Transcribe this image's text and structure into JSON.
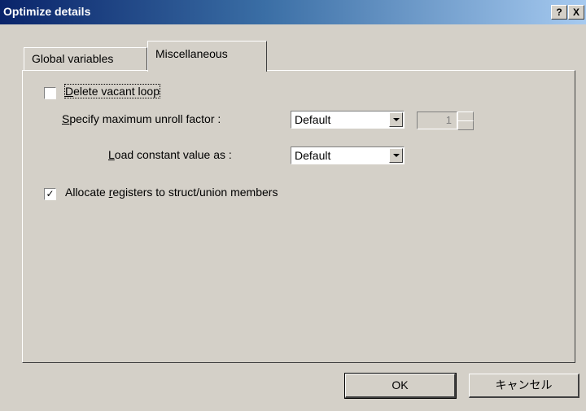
{
  "window": {
    "title": "Optimize details",
    "help_button": "?",
    "close_button": "X"
  },
  "tabs": [
    {
      "label": "Global variables",
      "active": false
    },
    {
      "label": "Miscellaneous",
      "active": true
    }
  ],
  "options": {
    "delete_vacant_loop": {
      "mnemonic": "D",
      "rest": "elete vacant loop",
      "checked": false
    },
    "unroll_factor": {
      "mnemonic": "S",
      "rest": "pecify maximum unroll factor :",
      "value": "Default",
      "spin_value": "1"
    },
    "load_constant": {
      "mnemonic": "L",
      "rest": "oad constant value as :",
      "value": "Default"
    },
    "allocate_registers": {
      "before": "Allocate ",
      "mnemonic": "r",
      "after": "egisters to struct/union members",
      "checked": true
    }
  },
  "buttons": {
    "ok": "OK",
    "cancel": "キャンセル"
  },
  "colors": {
    "dialog_bg": "#d4d0c8",
    "title_start": "#0a246a",
    "title_end": "#a6caf0"
  }
}
